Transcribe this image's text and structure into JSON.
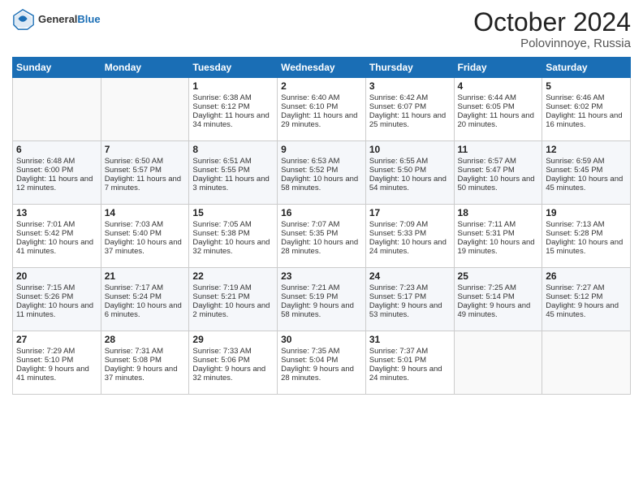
{
  "header": {
    "logo_general": "General",
    "logo_blue": "Blue",
    "month_title": "October 2024",
    "location": "Polovinnoye, Russia"
  },
  "weekdays": [
    "Sunday",
    "Monday",
    "Tuesday",
    "Wednesday",
    "Thursday",
    "Friday",
    "Saturday"
  ],
  "weeks": [
    [
      null,
      null,
      {
        "day": 1,
        "sunrise": "6:38 AM",
        "sunset": "6:12 PM",
        "daylight": "11 hours and 34 minutes."
      },
      {
        "day": 2,
        "sunrise": "6:40 AM",
        "sunset": "6:10 PM",
        "daylight": "11 hours and 29 minutes."
      },
      {
        "day": 3,
        "sunrise": "6:42 AM",
        "sunset": "6:07 PM",
        "daylight": "11 hours and 25 minutes."
      },
      {
        "day": 4,
        "sunrise": "6:44 AM",
        "sunset": "6:05 PM",
        "daylight": "11 hours and 20 minutes."
      },
      {
        "day": 5,
        "sunrise": "6:46 AM",
        "sunset": "6:02 PM",
        "daylight": "11 hours and 16 minutes."
      }
    ],
    [
      {
        "day": 6,
        "sunrise": "6:48 AM",
        "sunset": "6:00 PM",
        "daylight": "11 hours and 12 minutes."
      },
      {
        "day": 7,
        "sunrise": "6:50 AM",
        "sunset": "5:57 PM",
        "daylight": "11 hours and 7 minutes."
      },
      {
        "day": 8,
        "sunrise": "6:51 AM",
        "sunset": "5:55 PM",
        "daylight": "11 hours and 3 minutes."
      },
      {
        "day": 9,
        "sunrise": "6:53 AM",
        "sunset": "5:52 PM",
        "daylight": "10 hours and 58 minutes."
      },
      {
        "day": 10,
        "sunrise": "6:55 AM",
        "sunset": "5:50 PM",
        "daylight": "10 hours and 54 minutes."
      },
      {
        "day": 11,
        "sunrise": "6:57 AM",
        "sunset": "5:47 PM",
        "daylight": "10 hours and 50 minutes."
      },
      {
        "day": 12,
        "sunrise": "6:59 AM",
        "sunset": "5:45 PM",
        "daylight": "10 hours and 45 minutes."
      }
    ],
    [
      {
        "day": 13,
        "sunrise": "7:01 AM",
        "sunset": "5:42 PM",
        "daylight": "10 hours and 41 minutes."
      },
      {
        "day": 14,
        "sunrise": "7:03 AM",
        "sunset": "5:40 PM",
        "daylight": "10 hours and 37 minutes."
      },
      {
        "day": 15,
        "sunrise": "7:05 AM",
        "sunset": "5:38 PM",
        "daylight": "10 hours and 32 minutes."
      },
      {
        "day": 16,
        "sunrise": "7:07 AM",
        "sunset": "5:35 PM",
        "daylight": "10 hours and 28 minutes."
      },
      {
        "day": 17,
        "sunrise": "7:09 AM",
        "sunset": "5:33 PM",
        "daylight": "10 hours and 24 minutes."
      },
      {
        "day": 18,
        "sunrise": "7:11 AM",
        "sunset": "5:31 PM",
        "daylight": "10 hours and 19 minutes."
      },
      {
        "day": 19,
        "sunrise": "7:13 AM",
        "sunset": "5:28 PM",
        "daylight": "10 hours and 15 minutes."
      }
    ],
    [
      {
        "day": 20,
        "sunrise": "7:15 AM",
        "sunset": "5:26 PM",
        "daylight": "10 hours and 11 minutes."
      },
      {
        "day": 21,
        "sunrise": "7:17 AM",
        "sunset": "5:24 PM",
        "daylight": "10 hours and 6 minutes."
      },
      {
        "day": 22,
        "sunrise": "7:19 AM",
        "sunset": "5:21 PM",
        "daylight": "10 hours and 2 minutes."
      },
      {
        "day": 23,
        "sunrise": "7:21 AM",
        "sunset": "5:19 PM",
        "daylight": "9 hours and 58 minutes."
      },
      {
        "day": 24,
        "sunrise": "7:23 AM",
        "sunset": "5:17 PM",
        "daylight": "9 hours and 53 minutes."
      },
      {
        "day": 25,
        "sunrise": "7:25 AM",
        "sunset": "5:14 PM",
        "daylight": "9 hours and 49 minutes."
      },
      {
        "day": 26,
        "sunrise": "7:27 AM",
        "sunset": "5:12 PM",
        "daylight": "9 hours and 45 minutes."
      }
    ],
    [
      {
        "day": 27,
        "sunrise": "7:29 AM",
        "sunset": "5:10 PM",
        "daylight": "9 hours and 41 minutes."
      },
      {
        "day": 28,
        "sunrise": "7:31 AM",
        "sunset": "5:08 PM",
        "daylight": "9 hours and 37 minutes."
      },
      {
        "day": 29,
        "sunrise": "7:33 AM",
        "sunset": "5:06 PM",
        "daylight": "9 hours and 32 minutes."
      },
      {
        "day": 30,
        "sunrise": "7:35 AM",
        "sunset": "5:04 PM",
        "daylight": "9 hours and 28 minutes."
      },
      {
        "day": 31,
        "sunrise": "7:37 AM",
        "sunset": "5:01 PM",
        "daylight": "9 hours and 24 minutes."
      },
      null,
      null
    ]
  ]
}
